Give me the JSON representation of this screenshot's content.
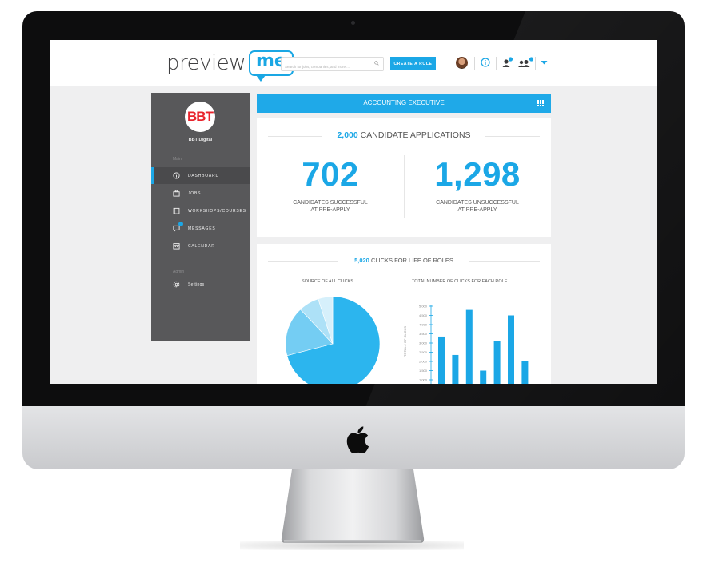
{
  "app": {
    "logo_text": "preview",
    "logo_highlight": "me",
    "search_placeholder": "Search for jobs, companies, and more....",
    "create_role_label": "CREATE A ROLE"
  },
  "sidebar": {
    "company_logo_text": "BBT",
    "company_name": "BBT Digital",
    "section_main": "Main",
    "section_admin": "Admin",
    "items": [
      {
        "label": "DASHBOARD",
        "icon": "info-icon",
        "active": true
      },
      {
        "label": "JOBS",
        "icon": "briefcase-icon"
      },
      {
        "label": "WORKSHOPS/COURSES",
        "icon": "book-icon"
      },
      {
        "label": "MESSAGES",
        "icon": "chat-icon"
      },
      {
        "label": "CALENDAR",
        "icon": "calendar-icon"
      }
    ],
    "settings_label": "Settings"
  },
  "role": {
    "title": "ACCOUNTING EXECUTIVE"
  },
  "applications": {
    "count": "2,000",
    "heading": "CANDIDATE APPLICATIONS",
    "successful_value": "702",
    "successful_label_1": "CANDIDATES SUCCESSFUL",
    "successful_label_2": "AT PRE-APPLY",
    "unsuccessful_value": "1,298",
    "unsuccessful_label_1": "CANDIDATES UNSUCCESSFUL",
    "unsuccessful_label_2": "AT PRE-APPLY"
  },
  "clicks": {
    "count": "5,020",
    "heading": "CLICKS FOR LIFE OF ROLES",
    "pie_title": "SOURCE OF ALL CLICKS",
    "bar_title": "TOTAL NUMBER OF CLICKS FOR EACH ROLE"
  },
  "colors": {
    "accent": "#1ba7e6",
    "sidebar": "#58585a",
    "screen_bg": "#efeff0"
  },
  "chart_data": [
    {
      "type": "pie",
      "title": "SOURCE OF ALL CLICKS",
      "slices": [
        {
          "value": 71,
          "color": "#2cb5ee"
        },
        {
          "value": 17,
          "color": "#74cdf3"
        },
        {
          "value": 7,
          "color": "#ade1f7"
        },
        {
          "value": 5,
          "color": "#d6f0fb"
        }
      ]
    },
    {
      "type": "bar",
      "title": "TOTAL NUMBER OF CLICKS FOR EACH ROLE",
      "ylabel": "TOTAL # OF CLICKS",
      "yticks": [
        "1,000",
        "1,500",
        "2,000",
        "2,500",
        "3,000",
        "3,500",
        "4,000",
        "4,500",
        "5,000"
      ],
      "ylim": [
        1000,
        5000
      ],
      "values": [
        3350,
        2350,
        4800,
        1500,
        3100,
        4500,
        2000
      ]
    }
  ]
}
